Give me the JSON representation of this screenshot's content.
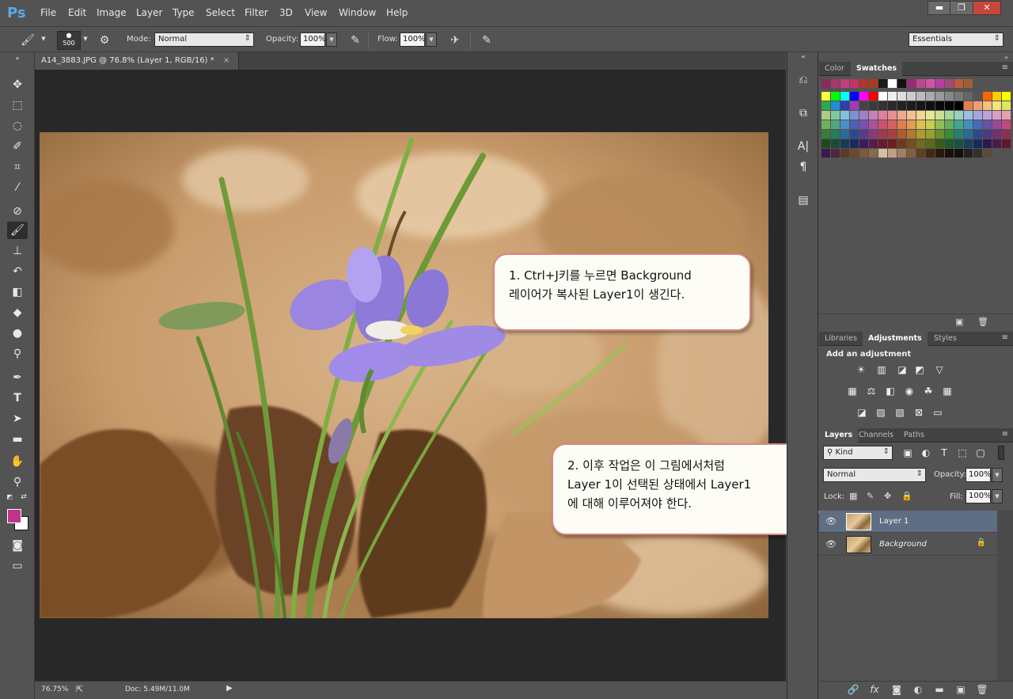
{
  "app": {
    "logo": "Ps",
    "menu": [
      "File",
      "Edit",
      "Image",
      "Layer",
      "Type",
      "Select",
      "Filter",
      "3D",
      "View",
      "Window",
      "Help"
    ],
    "window_controls": {
      "minimize": "▬",
      "restore": "❐",
      "close": "✕"
    }
  },
  "options": {
    "brush_size": "500",
    "mode_label": "Mode:",
    "mode_value": "Normal",
    "opacity_label": "Opacity:",
    "opacity_value": "100%",
    "flow_label": "Flow:",
    "flow_value": "100%",
    "workspace": "Essentials"
  },
  "document": {
    "tab_title": "A14_3883.JPG @ 76.8% (Layer 1, RGB/16) *",
    "tab_close": "×",
    "zoom": "76.75%",
    "doc_size": "Doc: 5.49M/11.0M"
  },
  "callouts": {
    "first": {
      "line1": "1. Ctrl+J키를 누르면 Background",
      "line2": "레이어가 복사된 Layer1이 생긴다."
    },
    "second": {
      "line1": "2. 이후 작업은 이 그림에서처럼",
      "line2": "Layer 1이 선택된 상태에서 Layer1",
      "line3": "에 대해 이루어져야 한다."
    }
  },
  "panels": {
    "color_tabs": [
      "Color",
      "Swatches"
    ],
    "active_color_tab": "Swatches",
    "adj_tabs": [
      "Libraries",
      "Adjustments",
      "Styles"
    ],
    "active_adj_tab": "Adjustments",
    "adj_heading": "Add an adjustment",
    "layer_tabs": [
      "Layers",
      "Channels",
      "Paths"
    ],
    "active_layer_tab": "Layers",
    "kind_label": "Kind",
    "blend_mode": "Normal",
    "opacity_label": "Opacity:",
    "opacity_value": "100%",
    "lock_label": "Lock:",
    "fill_label": "Fill:",
    "fill_value": "100%",
    "layers": [
      {
        "name": "Layer 1",
        "selected": true,
        "locked": false
      },
      {
        "name": "Background",
        "selected": false,
        "locked": true
      }
    ]
  },
  "colors": {
    "foreground": "#c0338a",
    "background": "#ffffff",
    "selected_layer": "#5f6e82",
    "callout_border": "#d98585"
  },
  "swatch_rows": [
    [
      "#8a2a5a",
      "#a33a6a",
      "#c13d7f",
      "#c03566",
      "#b2342f",
      "#ab3a24",
      "#1a1a1a",
      "#ffffff",
      "#111111",
      "#9b2a7a",
      "#c04690",
      "#d054a0",
      "#b63fa2",
      "#a04a7a",
      "#c05a3a",
      "#a06030"
    ],
    [
      "#ffff3a",
      "#00ff00",
      "#00ffff",
      "#0000ff",
      "#ff00ff",
      "#ff0000",
      "#ffffff",
      "#eeeeee",
      "#dddddd",
      "#cccccc",
      "#bbbbbb",
      "#aaaaaa",
      "#999999",
      "#888888",
      "#777777",
      "#666666",
      "#555555",
      "#ff6600",
      "#ffcc00",
      "#ffff00"
    ],
    [
      "#2ea84a",
      "#1e8fd6",
      "#2c3fae",
      "#a43ab5",
      "#444444",
      "#3a3a3a",
      "#333333",
      "#2a2a2a",
      "#222222",
      "#1c1c1c",
      "#161616",
      "#101010",
      "#0a0a0a",
      "#050505",
      "#000000",
      "#e08050",
      "#f0a070",
      "#f5c078",
      "#f8e080",
      "#d8e860"
    ],
    [
      "#a8d080",
      "#80c8a0",
      "#80c0e0",
      "#8090d0",
      "#a080c8",
      "#c880b8",
      "#e080a0",
      "#e89090",
      "#f0a890",
      "#f0c090",
      "#f0d890",
      "#e8e890",
      "#c8e090",
      "#a8d898",
      "#98d0c0",
      "#98c0e0",
      "#a0a8e0",
      "#c0a0d8",
      "#d8a0c8",
      "#e8a0b0"
    ],
    [
      "#70b060",
      "#50a880",
      "#4a90c8",
      "#4a60b8",
      "#7a50b0",
      "#b050a0",
      "#d05070",
      "#d86060",
      "#e08050",
      "#e0a050",
      "#e0c050",
      "#c8d050",
      "#90c050",
      "#60b060",
      "#40a890",
      "#4090c0",
      "#4a6ab8",
      "#6a50a8",
      "#9a4898",
      "#c04880"
    ],
    [
      "#3a7a3a",
      "#2a7a60",
      "#2a6a9a",
      "#2a4a8a",
      "#5a3a8a",
      "#8a3a7a",
      "#a03a50",
      "#a84040",
      "#b05a30",
      "#b07a30",
      "#b09a30",
      "#98a030",
      "#68902e",
      "#3a8a3a",
      "#2a8070",
      "#2a6a98",
      "#2a4a88",
      "#4a3a80",
      "#723070",
      "#903050"
    ],
    [
      "#1e4a1e",
      "#1a4a3a",
      "#1a3a5a",
      "#1a2a5a",
      "#3a1a5a",
      "#5a1a4a",
      "#6a1a30",
      "#6a2020",
      "#703a1a",
      "#705020",
      "#706a1a",
      "#5a6a1a",
      "#3a5a1a",
      "#1e5a2a",
      "#1a5048",
      "#1a4060",
      "#1a2a58",
      "#2a1a50",
      "#4a1a48",
      "#5a1a30"
    ],
    [
      "#3a1a4a",
      "#4a2a3a",
      "#5a3a2a",
      "#6a4a2a",
      "#7a5a3a",
      "#8a6a4a",
      "#d6c0a0",
      "#c0a080",
      "#a08060",
      "#806040",
      "#604020",
      "#402a14",
      "#2a1a0a",
      "#1a1008",
      "#101008",
      "#202020",
      "#303030",
      "#5a4a3a"
    ]
  ]
}
